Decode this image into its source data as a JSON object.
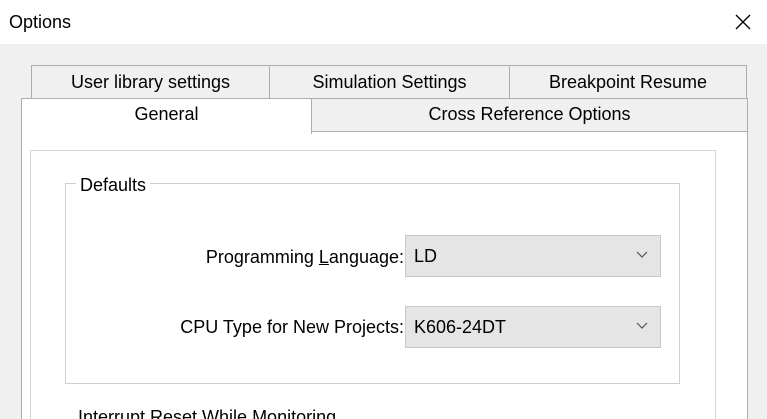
{
  "window": {
    "title": "Options"
  },
  "tabs": {
    "back_row": [
      {
        "label": "User library settings"
      },
      {
        "label": "Simulation Settings"
      },
      {
        "label": "Breakpoint Resume"
      }
    ],
    "front_row": [
      {
        "label": "General",
        "selected": true
      },
      {
        "label": "Cross Reference Options"
      }
    ]
  },
  "defaults": {
    "group_title": "Defaults",
    "programming_language": {
      "label_prefix": "Programming ",
      "label_underlined": "L",
      "label_suffix": "anguage:",
      "value": "LD"
    },
    "cpu_type": {
      "label": "CPU Type for New Projects:",
      "value": "K606-24DT"
    }
  },
  "partial_next_section": {
    "text": "Interrupt Reset While Monitoring"
  },
  "icons": {
    "close": "close-icon",
    "dropdown": "chevron-down-icon"
  }
}
